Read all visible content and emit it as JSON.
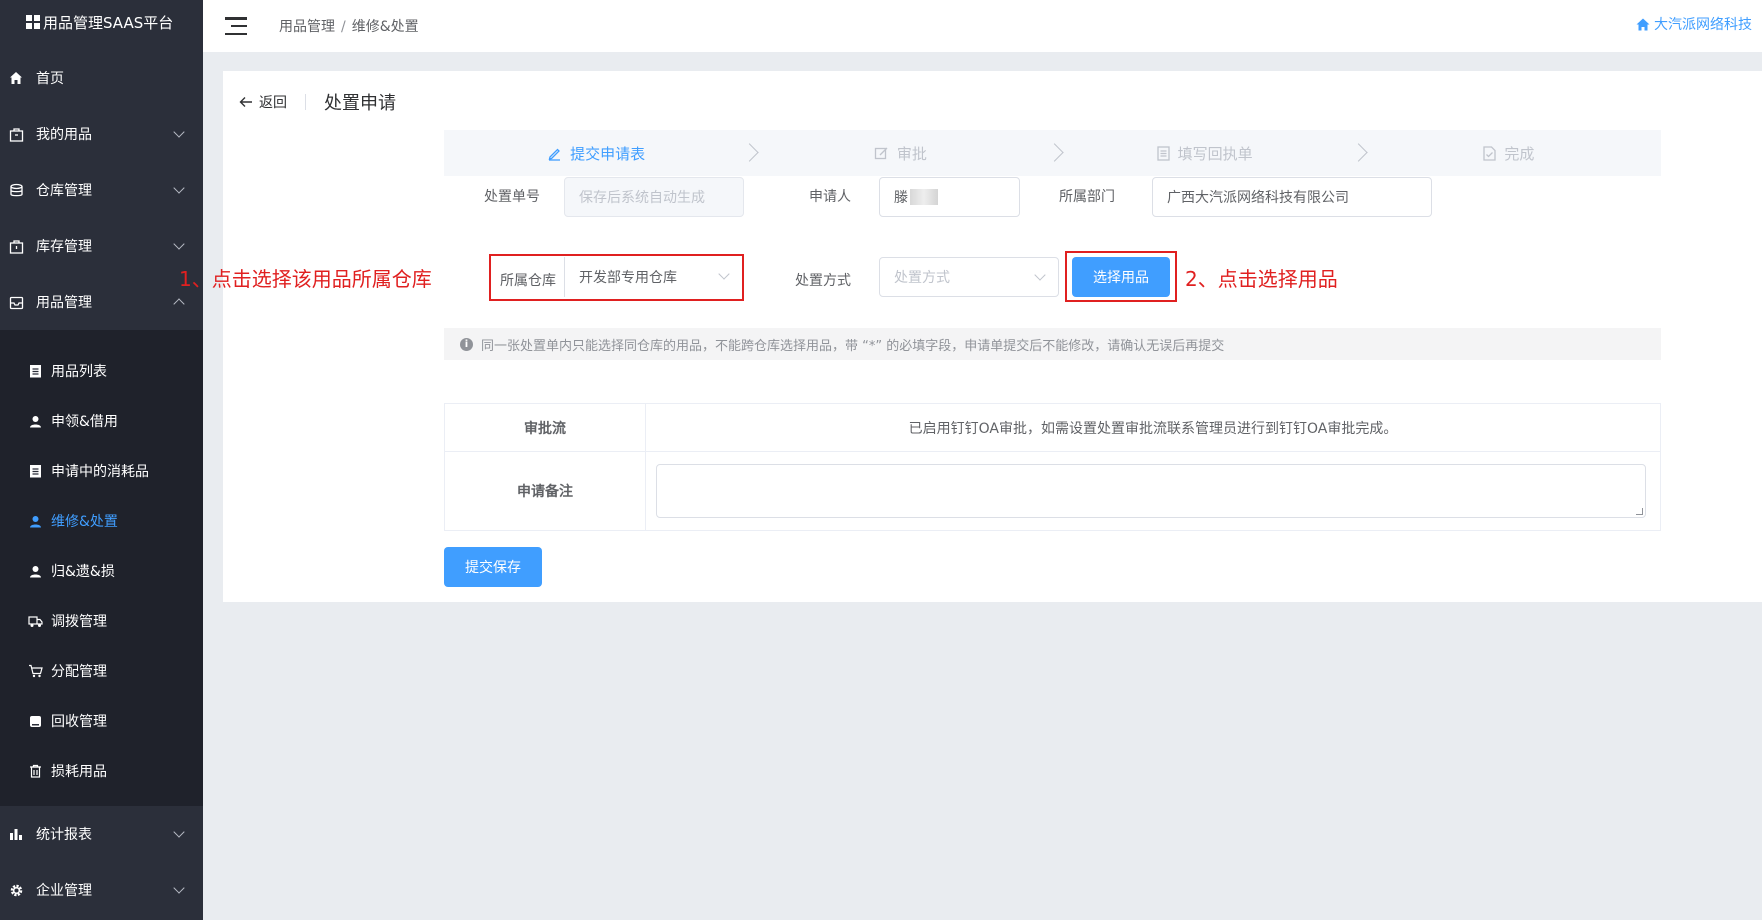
{
  "app": {
    "title": "用品管理SAAS平台"
  },
  "sidebar": {
    "top_items": [
      {
        "label": "首页",
        "icon": "home-icon"
      },
      {
        "label": "我的用品",
        "icon": "bag-icon"
      },
      {
        "label": "仓库管理",
        "icon": "database-icon"
      },
      {
        "label": "库存管理",
        "icon": "box-icon"
      },
      {
        "label": "用品管理",
        "icon": "inbox-icon"
      }
    ],
    "sub_items": [
      {
        "label": "用品列表",
        "icon": "clipboard-icon"
      },
      {
        "label": "申领&借用",
        "icon": "user-icon"
      },
      {
        "label": "申请中的消耗品",
        "icon": "clipboard-icon"
      },
      {
        "label": "维修&处置",
        "icon": "user-icon",
        "active": true
      },
      {
        "label": "归&遗&损",
        "icon": "user-icon"
      },
      {
        "label": "调拨管理",
        "icon": "truck-icon"
      },
      {
        "label": "分配管理",
        "icon": "cart-icon"
      },
      {
        "label": "回收管理",
        "icon": "recycle-icon"
      },
      {
        "label": "损耗用品",
        "icon": "trash-icon"
      }
    ],
    "bottom_items": [
      {
        "label": "统计报表",
        "icon": "bar-chart-icon"
      },
      {
        "label": "企业管理",
        "icon": "gear-icon"
      }
    ]
  },
  "header": {
    "breadcrumb": [
      "用品管理",
      "维修&处置"
    ],
    "breadcrumb_sep": "/",
    "company": "大汽派网络科技"
  },
  "page": {
    "back_label": "返回",
    "title": "处置申请"
  },
  "steps": [
    {
      "label": "提交申请表",
      "icon": "edit-icon",
      "active": true
    },
    {
      "label": "审批",
      "icon": "edit-box-icon",
      "active": false
    },
    {
      "label": "填写回执单",
      "icon": "document-icon",
      "active": false
    },
    {
      "label": "完成",
      "icon": "check-doc-icon",
      "active": false
    }
  ],
  "form": {
    "order_no_label": "处置单号",
    "order_no_placeholder": "保存后系统自动生成",
    "applicant_label": "申请人",
    "applicant_value": "滕",
    "dept_label": "所属部门",
    "dept_value": "广西大汽派网络科技有限公司",
    "warehouse_label": "所属仓库",
    "warehouse_value": "开发部专用仓库",
    "method_label": "处置方式",
    "method_placeholder": "处置方式",
    "select_goods_label": "选择用品"
  },
  "annotations": {
    "note1": "1、点击选择该用品所属仓库",
    "note2": "2、点击选择用品"
  },
  "tip": "同一张处置单内只能选择同仓库的用品，不能跨仓库选择用品，带 “*” 的必填字段，申请单提交后不能修改，请确认无误后再提交",
  "table": {
    "flow_label": "审批流",
    "flow_value": "已启用钉钉OA审批，如需设置处置审批流联系管理员进行到钉钉OA审批完成。",
    "remark_label": "申请备注"
  },
  "submit_label": "提交保存",
  "colors": {
    "primary": "#409eff",
    "sidebar": "#2b2f3a",
    "annotation": "#e02020"
  }
}
